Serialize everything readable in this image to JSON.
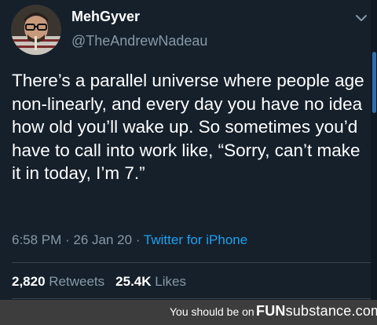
{
  "tweet": {
    "display_name": "MehGyver",
    "handle": "@TheAndrewNadeau",
    "text": "There’s a parallel universe where people age non-linearly, and every day you have no idea how old you’ll wake up. So sometimes you’d have to call into work like, “Sorry, can’t make it in today, I’m 7.”",
    "time": "6:58 PM",
    "separator": " · ",
    "date": "26 Jan 20",
    "source": "Twitter for iPhone",
    "retweets_count": "2,820",
    "retweets_label": "Retweets",
    "likes_count": "25.4K",
    "likes_label": "Likes"
  },
  "watermark": {
    "prefix": "You should be on",
    "brand_bold": "FUN",
    "brand_rest": "substance.com"
  },
  "colors": {
    "background": "#15202b",
    "secondary_text": "#8899a6",
    "link": "#1da1f2",
    "divider": "#38444d"
  },
  "icons": {
    "menu": "chevron-down-icon"
  }
}
